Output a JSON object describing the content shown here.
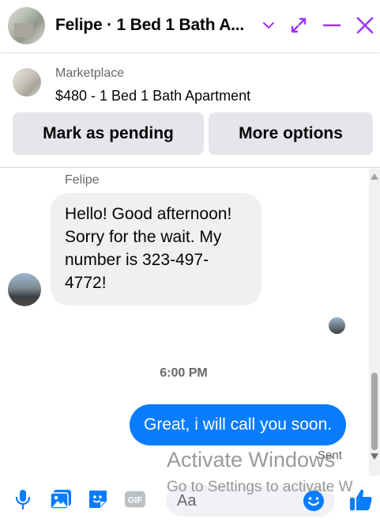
{
  "header": {
    "title": "Felipe · 1 Bed 1 Bath A...",
    "icons": [
      "chevron-down-icon",
      "expand-icon",
      "minimize-icon",
      "close-icon"
    ],
    "accent_color": "#a033ff"
  },
  "marketplace": {
    "label": "Marketplace",
    "listing_title": "$480 - 1 Bed 1 Bath Apartment",
    "buttons": {
      "pending": "Mark as pending",
      "more": "More options"
    }
  },
  "conversation": {
    "incoming": {
      "sender": "Felipe",
      "text": "Hello! Good afternoon! Sorry for the wait. My number is 323-497-4772!"
    },
    "timestamp": "6:00 PM",
    "outgoing": {
      "text": "Great, i will call you soon.",
      "status": "Sent",
      "bubble_color": "#0a7cff"
    }
  },
  "watermark": {
    "line1": "Activate Windows",
    "line2": "Go to Settings to activate W"
  },
  "composer": {
    "placeholder": "Aa",
    "icons": [
      "microphone-icon",
      "photo-icon",
      "sticker-icon",
      "gif-icon",
      "emoji-icon",
      "like-icon"
    ],
    "gif_label": "GIF",
    "icon_color": "#0a7cff"
  }
}
